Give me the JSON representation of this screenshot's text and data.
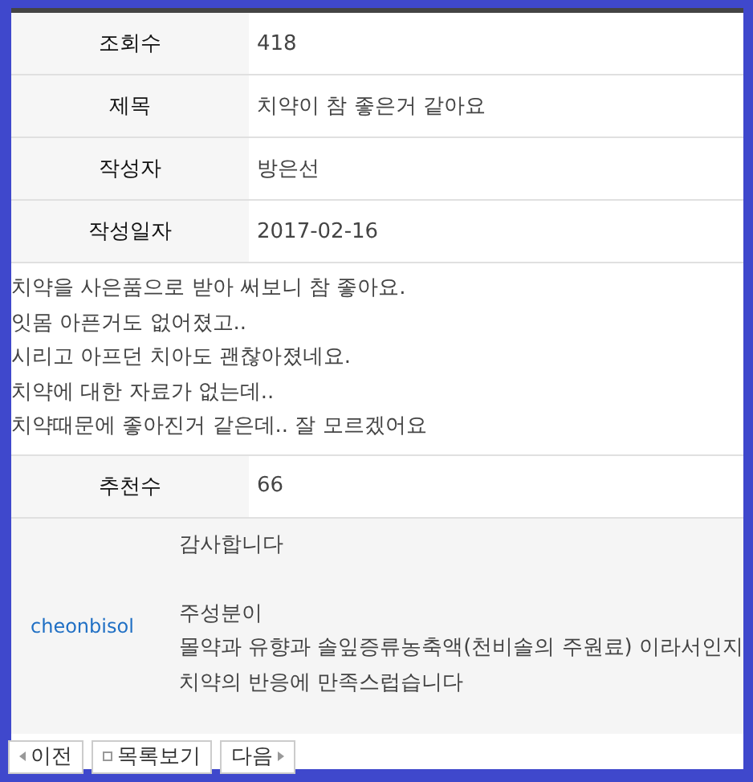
{
  "fields": [
    {
      "label": "조회수",
      "value": "418"
    },
    {
      "label": "제목",
      "value": "치약이 참 좋은거 같아요"
    },
    {
      "label": "작성자",
      "value": "방은선"
    },
    {
      "label": "작성일자",
      "value": "2017-02-16"
    }
  ],
  "body": [
    "치약을 사은품으로 받아 써보니 참 좋아요.",
    "잇몸 아픈거도 없어졌고..",
    "시리고 아프던 치아도 괜찮아졌네요.",
    "치약에 대한 자료가 없는데..",
    "치약때문에 좋아진거 같은데.. 잘 모르겠어요"
  ],
  "recommend": {
    "label": "추천수",
    "value": "66"
  },
  "comment": {
    "author": "cheonbisol",
    "paragraphs": [
      [
        "감사합니다"
      ],
      [
        "주성분이",
        "몰약과 유향과 솔잎증류농축액(천비솔의 주원료) 이라서인지",
        "치약의 반응에 만족스럽습니다"
      ]
    ]
  },
  "buttons": [
    {
      "kind": "prev",
      "label": "이전"
    },
    {
      "kind": "list",
      "label": "목록보기"
    },
    {
      "kind": "next",
      "label": "다음"
    }
  ]
}
